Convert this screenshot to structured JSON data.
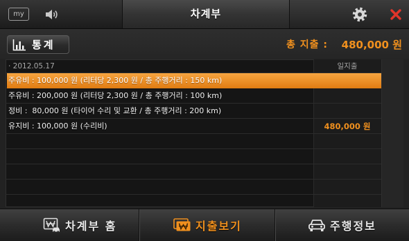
{
  "header": {
    "title": "차계부",
    "my_label": "my",
    "my_icon": "my-box-icon",
    "sound_icon": "speaker-icon",
    "settings_icon": "gear-icon",
    "close_icon": "close-icon"
  },
  "toolbar": {
    "stats_icon": "bar-chart-icon",
    "stats_label": "통계",
    "total_label": "총 지출 :",
    "total_value": "480,000 원"
  },
  "table": {
    "date": "· 2012.05.17",
    "daily_header": "일지출",
    "rows": [
      {
        "text": "주유비 : 100,000 원 (리터당 2,300 원 / 총 주행거리 : 150 km)",
        "selected": true
      },
      {
        "text": "주유비 : 200,000 원 (리터당 2,300 원 / 총 주행거리 : 100 km)",
        "selected": false
      },
      {
        "text": "정비 :  80,000 원 (타이어 수리 및 교환 / 총 주행거리 : 200 km)",
        "selected": false
      },
      {
        "text": "유지비 : 100,000 원 (수리비)",
        "daily": "480,000 원",
        "selected": false
      }
    ]
  },
  "nav": {
    "tabs": [
      {
        "label": "차계부 홈",
        "icon": "logbook-icon",
        "active": false
      },
      {
        "label": "지출보기",
        "icon": "expense-icon",
        "active": true
      },
      {
        "label": "주행정보",
        "icon": "car-icon",
        "active": false
      }
    ]
  },
  "colors": {
    "accent": "#f0901e",
    "close": "#e2352a",
    "selected_row_top": "#f7a540",
    "selected_row_bottom": "#e07c12",
    "text": "#ffffff",
    "muted": "#a8a8a8"
  }
}
